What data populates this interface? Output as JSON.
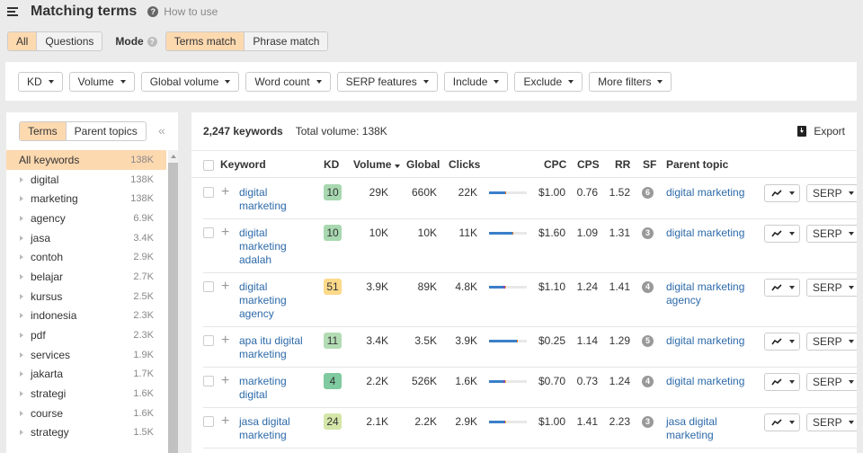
{
  "header": {
    "title": "Matching terms",
    "help_label": "How to use",
    "help_icon": "question-circle-icon",
    "menu_icon": "hamburger-menu-icon"
  },
  "scope_tabs": [
    {
      "label": "All",
      "active": true
    },
    {
      "label": "Questions",
      "active": false
    }
  ],
  "mode": {
    "label": "Mode",
    "options": [
      {
        "label": "Terms match",
        "active": true
      },
      {
        "label": "Phrase match",
        "active": false
      }
    ]
  },
  "filters": [
    "KD",
    "Volume",
    "Global volume",
    "Word count",
    "SERP features",
    "Include",
    "Exclude",
    "More filters"
  ],
  "sidebar": {
    "tabs": [
      {
        "label": "Terms",
        "active": true
      },
      {
        "label": "Parent topics",
        "active": false
      }
    ],
    "collapse_icon": "double-chevron-left-icon",
    "items": [
      {
        "label": "All keywords",
        "value": "138K",
        "selected": true
      },
      {
        "label": "digital",
        "value": "138K"
      },
      {
        "label": "marketing",
        "value": "138K"
      },
      {
        "label": "agency",
        "value": "6.9K"
      },
      {
        "label": "jasa",
        "value": "3.4K"
      },
      {
        "label": "contoh",
        "value": "2.9K"
      },
      {
        "label": "belajar",
        "value": "2.7K"
      },
      {
        "label": "kursus",
        "value": "2.5K"
      },
      {
        "label": "indonesia",
        "value": "2.3K"
      },
      {
        "label": "pdf",
        "value": "2.3K"
      },
      {
        "label": "services",
        "value": "1.9K"
      },
      {
        "label": "jakarta",
        "value": "1.7K"
      },
      {
        "label": "strategi",
        "value": "1.6K"
      },
      {
        "label": "course",
        "value": "1.6K"
      },
      {
        "label": "strategy",
        "value": "1.5K"
      }
    ]
  },
  "main": {
    "keyword_count": "2,247 keywords",
    "total_volume": "Total volume: 138K",
    "export_label": "Export",
    "columns": [
      "Keyword",
      "KD",
      "Volume",
      "Global",
      "Clicks",
      "CPC",
      "CPS",
      "RR",
      "SF",
      "Parent topic"
    ],
    "sorted_column": "Volume",
    "serp_label": "SERP",
    "rows": [
      {
        "keyword": [
          "digital",
          "marketing"
        ],
        "kd": "10",
        "kd_color": "#a8d8b0",
        "volume": "29K",
        "global": "660K",
        "clicks": "22K",
        "clicks_split": [
          0.42,
          0.02,
          0,
          0
        ],
        "cpc": "$1.00",
        "cps": "0.76",
        "rr": "1.52",
        "sf": "6",
        "parent": [
          "digital marketing"
        ]
      },
      {
        "keyword": [
          "digital",
          "marketing",
          "adalah"
        ],
        "kd": "10",
        "kd_color": "#a8d8b0",
        "volume": "10K",
        "global": "10K",
        "clicks": "11K",
        "clicks_split": [
          0.63,
          0.02,
          0,
          0
        ],
        "cpc": "$1.60",
        "cps": "1.09",
        "rr": "1.31",
        "sf": "3",
        "parent": [
          "digital marketing"
        ]
      },
      {
        "keyword": [
          "digital",
          "marketing",
          "agency"
        ],
        "kd": "51",
        "kd_color": "#fdd98a",
        "volume": "3.9K",
        "global": "89K",
        "clicks": "4.8K",
        "clicks_split": [
          0.38,
          0.08,
          0.08,
          0
        ],
        "cpc": "$1.10",
        "cps": "1.24",
        "rr": "1.41",
        "sf": "4",
        "parent": [
          "digital marketing",
          "agency"
        ]
      },
      {
        "keyword": [
          "apa itu digital",
          "marketing"
        ],
        "kd": "11",
        "kd_color": "#b3dcb5",
        "volume": "3.4K",
        "global": "3.5K",
        "clicks": "3.9K",
        "clicks_split": [
          0.73,
          0.02,
          0,
          0
        ],
        "cpc": "$0.25",
        "cps": "1.14",
        "rr": "1.29",
        "sf": "5",
        "parent": [
          "digital marketing"
        ]
      },
      {
        "keyword": [
          "marketing",
          "digital"
        ],
        "kd": "4",
        "kd_color": "#7fcaa0",
        "volume": "2.2K",
        "global": "526K",
        "clicks": "1.6K",
        "clicks_split": [
          0.38,
          0.02,
          0.07,
          0
        ],
        "cpc": "$0.70",
        "cps": "0.73",
        "rr": "1.24",
        "sf": "4",
        "parent": [
          "digital marketing"
        ]
      },
      {
        "keyword": [
          "jasa digital",
          "marketing"
        ],
        "kd": "24",
        "kd_color": "#d4e6a8",
        "volume": "2.1K",
        "global": "2.2K",
        "clicks": "2.9K",
        "clicks_split": [
          0.4,
          0.1,
          0.06,
          0
        ],
        "cpc": "$1.00",
        "cps": "1.41",
        "rr": "2.23",
        "sf": "3",
        "parent": [
          "jasa digital",
          "marketing"
        ]
      }
    ]
  },
  "colors": {
    "accent_active": "#fdd9b0",
    "link": "#2d6aa9",
    "click_organic": "#3a7fc9",
    "click_paid": "#8e44ad",
    "click_other": "#f5c342"
  }
}
